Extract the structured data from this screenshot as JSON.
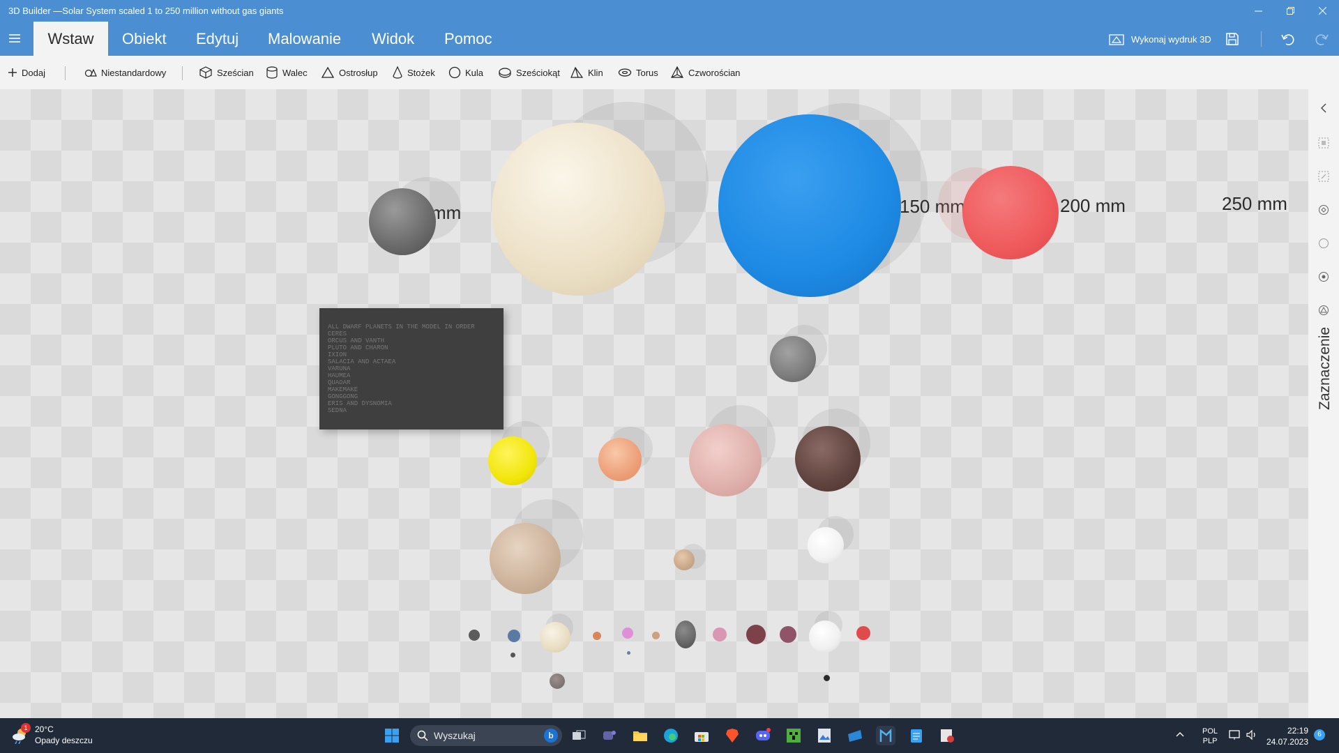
{
  "window": {
    "title": "3D Builder —Solar System scaled 1 to 250 million without gas giants"
  },
  "ribbon": {
    "tabs": [
      {
        "label": "Wstaw",
        "active": true
      },
      {
        "label": "Obiekt"
      },
      {
        "label": "Edytuj"
      },
      {
        "label": "Malowanie"
      },
      {
        "label": "Widok"
      },
      {
        "label": "Pomoc"
      }
    ],
    "print_label": "Wykonaj wydruk 3D"
  },
  "toolbar": {
    "add": "Dodaj",
    "custom": "Niestandardowy",
    "shapes": [
      "Sześcian",
      "Walec",
      "Ostrosłup",
      "Stożek",
      "Kula",
      "Sześciokąt",
      "Klin",
      "Torus",
      "Czworościan"
    ]
  },
  "viewport": {
    "labels": [
      "mm",
      "150 mm",
      "200 mm",
      "250 mm"
    ],
    "plaque_lines": [
      "ALL DWARF PLANETS IN THE MODEL IN ORDER",
      "CERES",
      "ORCUS AND VANTH",
      "PLUTO AND CHARON",
      "IXION",
      "SALACIA AND ACTAEA",
      "VARUNA",
      "HAUMEA",
      "QUAOAR",
      "MAKEMAKE",
      "GONGGONG",
      "ERIS AND DYSNOMIA",
      "SEDNA"
    ],
    "colors": {
      "mercury": "#777777",
      "venus": "#ede2c8",
      "earth": "#1e8ae4",
      "mars": "#ef5a5c",
      "moon": "#8a8a8a",
      "yellow_moon": "#f2e60a"
    }
  },
  "side_panel": {
    "label": "Zaznaczenie"
  },
  "taskbar": {
    "weather_temp": "20°C",
    "weather_desc": "Opady deszczu",
    "weather_badge": "1",
    "search": "Wyszukaj",
    "lang": "POL",
    "layout": "PLP",
    "time": "22:19",
    "date": "24.07.2023",
    "notif_count": "6"
  }
}
